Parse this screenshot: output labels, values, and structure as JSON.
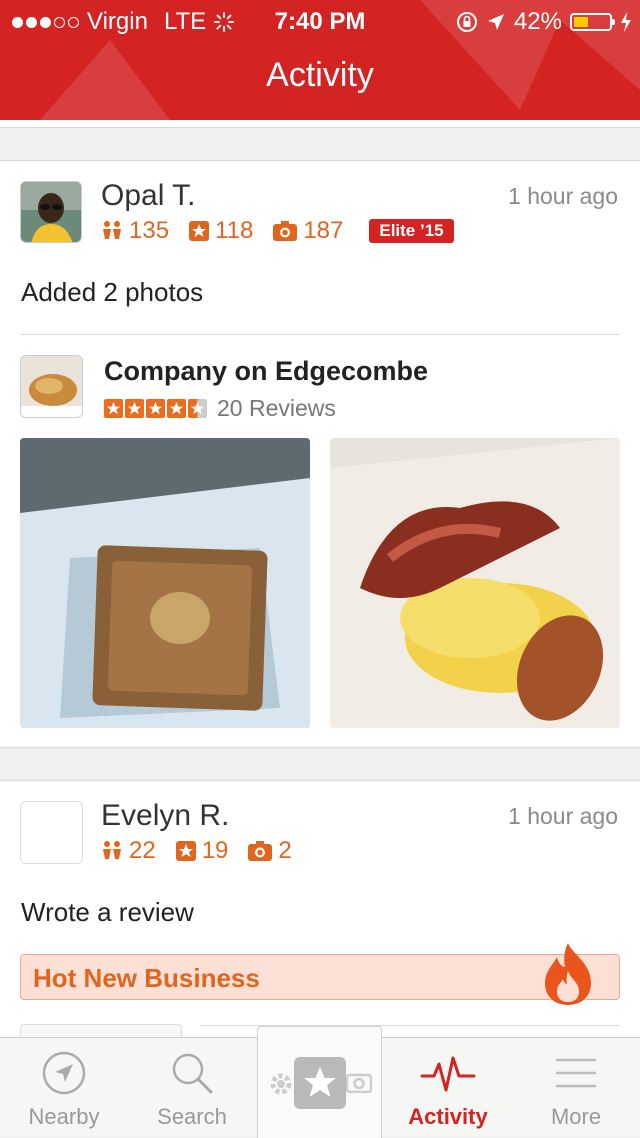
{
  "status": {
    "carrier": "Virgin",
    "network": "LTE",
    "time": "7:40 PM",
    "battery": "42%",
    "battery_fraction": 0.42
  },
  "nav": {
    "title": "Activity"
  },
  "feed": [
    {
      "user": "Opal T.",
      "time_ago": "1 hour ago",
      "friends": "135",
      "reviews": "118",
      "photos": "187",
      "elite": "Elite ’15",
      "action": "Added 2 photos",
      "business": {
        "name": "Company on Edgecombe",
        "rating": 4.5,
        "reviews_label": "20 Reviews"
      }
    },
    {
      "user": "Evelyn R.",
      "time_ago": "1 hour ago",
      "friends": "22",
      "reviews": "19",
      "photos": "2",
      "action": "Wrote a review",
      "badge": "Hot New Business"
    }
  ],
  "tabs": [
    {
      "label": "Nearby",
      "icon": "compass-icon"
    },
    {
      "label": "Search",
      "icon": "search-icon"
    },
    {
      "label": "",
      "icon": "check-in-star-icon"
    },
    {
      "label": "Activity",
      "icon": "pulse-icon"
    },
    {
      "label": "More",
      "icon": "menu-icon"
    }
  ],
  "colors": {
    "brand": "#d32323",
    "accent": "#e0661f"
  }
}
